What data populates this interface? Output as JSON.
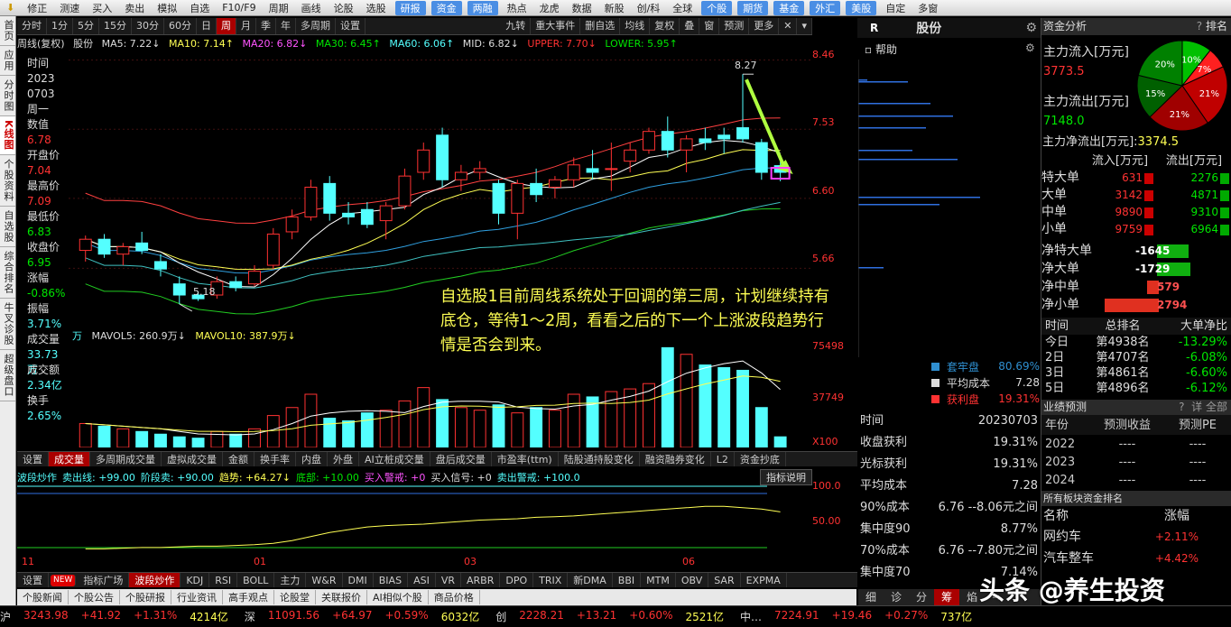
{
  "toolbar": {
    "items": [
      "修正",
      "测速",
      "买入",
      "卖出",
      "模拟",
      "自选",
      "F10/F9",
      "周期",
      "画线",
      "论股",
      "选股",
      "研报",
      "资金",
      "两融",
      "热点",
      "龙虎",
      "数据",
      "新股",
      "创/科",
      "全球",
      "个股",
      "期货",
      "基金",
      "外汇",
      "美股",
      "自定",
      "多窗"
    ],
    "highlighted": [
      "研报",
      "资金",
      "两融",
      "个股",
      "期货",
      "基金",
      "外汇",
      "美股"
    ]
  },
  "sidebar": {
    "items": [
      "首页",
      "应用",
      "分时图",
      "K线图",
      "个股资料",
      "自选股",
      "综合排名",
      "牛叉诊股",
      "超级盘口"
    ],
    "active": "K线图"
  },
  "period_tabs": [
    "分时",
    "1分",
    "5分",
    "15分",
    "30分",
    "60分",
    "日",
    "周",
    "月",
    "季",
    "年",
    "多周期",
    "设置"
  ],
  "active_period": "周",
  "right_tabs": [
    "九转",
    "重大事件",
    "删自选",
    "均线",
    "复权",
    "叠",
    "窗",
    "预测",
    "更多"
  ],
  "ma_line": {
    "title": "周线(复权)",
    "stock": "股份",
    "ma5": "MA5: 7.22↓",
    "ma10": "MA10: 7.14↑",
    "ma20": "MA20: 6.82↓",
    "ma30": "MA30: 6.45↑",
    "ma60": "MA60: 6.06↑",
    "mid": "MID: 6.82↓",
    "upper": "UPPER: 7.70↓",
    "lower": "LOWER: 5.95↑"
  },
  "info_panel": {
    "time_label": "时间",
    "year": "2023",
    "date": "0703",
    "weekday": "周一",
    "value_label": "数值",
    "value": "6.78",
    "open_label": "开盘价",
    "open": "7.04",
    "high_label": "最高价",
    "high": "7.09",
    "low_label": "最低价",
    "low": "6.83",
    "close_label": "收盘价",
    "close": "6.95",
    "change_label": "涨幅",
    "change": "-0.86%",
    "amp_label": "振幅",
    "amp": "3.71%",
    "vol_label": "成交量",
    "vol": "33.73万",
    "amt_label": "成交额",
    "amt": "2.34亿",
    "turn_label": "换手",
    "turn": "2.65%"
  },
  "price_axis": [
    "8.46",
    "7.53",
    "6.60",
    "5.66"
  ],
  "volume_axis": [
    "75498",
    "37749",
    "X100"
  ],
  "indicator_axis": [
    "100.0",
    "50.00"
  ],
  "date_axis": [
    "11",
    "01",
    "03",
    "06"
  ],
  "high_label": "8.27",
  "low_label": "5.18",
  "chart_data": {
    "type": "candlestick",
    "period": "weekly",
    "ohlc": [
      [
        5.9,
        6.1,
        5.75,
        6.05
      ],
      [
        6.05,
        6.12,
        5.8,
        5.85
      ],
      [
        5.85,
        6.0,
        5.7,
        5.95
      ],
      [
        6.0,
        6.15,
        5.85,
        5.9
      ],
      [
        5.75,
        5.85,
        5.55,
        5.65
      ],
      [
        5.45,
        5.55,
        5.18,
        5.3
      ],
      [
        5.3,
        5.35,
        5.22,
        5.25
      ],
      [
        5.3,
        5.55,
        5.25,
        5.48
      ],
      [
        5.48,
        5.55,
        5.35,
        5.4
      ],
      [
        5.45,
        5.7,
        5.42,
        5.62
      ],
      [
        5.7,
        6.2,
        5.65,
        6.12
      ],
      [
        6.15,
        6.45,
        6.05,
        6.35
      ],
      [
        6.35,
        6.85,
        6.3,
        6.75
      ],
      [
        6.8,
        6.9,
        6.3,
        6.4
      ],
      [
        6.4,
        6.55,
        6.25,
        6.35
      ],
      [
        6.45,
        6.55,
        6.2,
        6.25
      ],
      [
        6.3,
        6.55,
        6.05,
        6.5
      ],
      [
        6.5,
        7.0,
        6.45,
        6.9
      ],
      [
        6.95,
        7.35,
        6.85,
        7.25
      ],
      [
        7.45,
        7.55,
        6.75,
        6.85
      ],
      [
        6.85,
        7.05,
        6.7,
        6.95
      ],
      [
        6.95,
        7.1,
        6.85,
        7.0
      ],
      [
        6.8,
        6.85,
        6.25,
        6.4
      ],
      [
        6.4,
        6.85,
        6.05,
        6.8
      ],
      [
        6.8,
        7.0,
        6.55,
        6.65
      ],
      [
        6.75,
        6.9,
        6.6,
        6.85
      ],
      [
        6.85,
        7.15,
        6.75,
        7.05
      ],
      [
        7.0,
        7.25,
        6.85,
        6.95
      ],
      [
        7.0,
        7.35,
        6.7,
        7.0
      ],
      [
        7.1,
        7.35,
        6.95,
        7.25
      ],
      [
        7.25,
        7.55,
        7.2,
        7.5
      ],
      [
        7.5,
        7.7,
        7.15,
        7.25
      ],
      [
        7.25,
        7.45,
        6.95,
        7.4
      ],
      [
        7.4,
        7.55,
        7.25,
        7.35
      ],
      [
        7.45,
        7.55,
        7.2,
        7.4
      ],
      [
        7.55,
        8.27,
        7.35,
        7.4
      ],
      [
        7.35,
        7.4,
        6.85,
        6.95
      ],
      [
        7.04,
        7.09,
        6.83,
        6.95
      ]
    ],
    "volume": [
      18,
      16,
      14,
      12,
      10,
      8,
      7,
      12,
      10,
      14,
      24,
      30,
      40,
      22,
      20,
      26,
      28,
      35,
      45,
      36,
      30,
      28,
      32,
      26,
      30,
      28,
      40,
      38,
      42,
      44,
      48,
      75,
      70,
      62,
      60,
      58,
      30,
      8
    ],
    "ylim": [
      4.9,
      8.6
    ]
  },
  "annotation": "自选股1目前周线系统处于回调的第三周，计划继续持有底仓，等待1～2周，看看之后的下一个上涨波段趋势行情是否会到来。",
  "vol_line": {
    "prefix": "万",
    "mavol5": "MAVOL5: 260.9万↓",
    "mavol10": "MAVOL10: 387.9万↓"
  },
  "indicator_tabs": [
    "设置",
    "成交量",
    "多周期成交量",
    "虚拟成交量",
    "金额",
    "换手率",
    "内盘",
    "外盘",
    "AI立桩成交量",
    "盘后成交量",
    "市盈率(ttm)",
    "陆股通持股变化",
    "融资融券变化",
    "L2",
    "资金抄底"
  ],
  "indicator_active": "成交量",
  "indicator_line": {
    "name": "波段炒作",
    "sell_line": "卖出线: +99.00",
    "stage_sell": "阶段卖: +90.00",
    "trend": "趋势: +64.27↓",
    "bottom": "底部: +10.00",
    "buy_warn": "买入警戒: +0",
    "buy_sig": "买入信号: +0",
    "sell_warn": "卖出警戒: +100.0",
    "explain": "指标说明"
  },
  "formula_tabs": [
    "设置",
    "NEW",
    "指标广场",
    "波段炒作",
    "KDJ",
    "RSI",
    "BOLL",
    "主力",
    "W&R",
    "DMI",
    "BIAS",
    "ASI",
    "VR",
    "ARBR",
    "DPO",
    "TRIX",
    "新DMA",
    "BBI",
    "MTM",
    "OBV",
    "SAR",
    "EXPMA"
  ],
  "formula_active": "波段炒作",
  "news_tabs": [
    "个股新闻",
    "个股公告",
    "个股研报",
    "行业资讯",
    "高手观点",
    "论股堂",
    "关联报价",
    "AI相似个股",
    "商品价格"
  ],
  "status_bar": [
    {
      "label": "沪",
      "price": "3243.98",
      "chg": "+41.92",
      "pct": "+1.31%",
      "amt": "4214亿"
    },
    {
      "label": "深",
      "price": "11091.56",
      "chg": "+64.97",
      "pct": "+0.59%",
      "amt": "6032亿"
    },
    {
      "label": "创",
      "price": "2228.21",
      "chg": "+13.21",
      "pct": "+0.60%",
      "amt": "2521亿"
    },
    {
      "label": "中…",
      "price": "7224.91",
      "chg": "+19.46",
      "pct": "+0.27%",
      "amt": "737亿"
    }
  ],
  "mid_panel": {
    "code": "R",
    "stock": "股份",
    "help": "帮助",
    "legend": [
      {
        "name": "套牢盘",
        "value": "80.69%",
        "color": "#2f8fd0"
      },
      {
        "name": "平均成本",
        "value": "7.28",
        "color": "#dddddd"
      },
      {
        "name": "获利盘",
        "value": "19.31%",
        "color": "#ff3232"
      }
    ],
    "rows": [
      {
        "label": "时间",
        "value": "20230703"
      },
      {
        "label": "收盘获利",
        "value": "19.31%"
      },
      {
        "label": "光标获利",
        "value": "19.31%"
      },
      {
        "label": "平均成本",
        "value": "7.28"
      },
      {
        "label": "90%成本",
        "value": "6.76",
        "extra": "--8.06元之间"
      },
      {
        "label": "集中度90",
        "value": "8.77%"
      },
      {
        "label": "70%成本",
        "value": "6.76",
        "extra": "--7.80元之间"
      },
      {
        "label": "集中度70",
        "value": "7.14%"
      }
    ],
    "tabs": [
      "细",
      "诊",
      "分",
      "筹",
      "焰",
      "→"
    ]
  },
  "right_panel": {
    "title": "资金分析",
    "tab": "排名",
    "inflow_label": "主力流入[万元]",
    "inflow": "3773.5",
    "outflow_label": "主力流出[万元]",
    "outflow": "7148.0",
    "net_label": "主力净流出[万元]:",
    "net": "3374.5",
    "pie": [
      {
        "label": "10%",
        "value": 10,
        "color": "#00c000"
      },
      {
        "label": "7%",
        "value": 7,
        "color": "#ff2020"
      },
      {
        "label": "21%",
        "value": 21,
        "color": "#c00000"
      },
      {
        "label": "21%",
        "value": 21,
        "color": "#a00000"
      },
      {
        "label": "15%",
        "value": 15,
        "color": "#006000"
      },
      {
        "label": "20%",
        "value": 20,
        "color": "#008000"
      }
    ],
    "flow_head": [
      "流入[万元]",
      "流出[万元]"
    ],
    "flows": [
      {
        "label": "特大单",
        "in": "631",
        "out": "2276"
      },
      {
        "label": "大单",
        "in": "3142",
        "out": "4871"
      },
      {
        "label": "中单",
        "in": "9890",
        "out": "9310"
      },
      {
        "label": "小单",
        "in": "9759",
        "out": "6964"
      }
    ],
    "nets": [
      {
        "label": "净特大单",
        "value": "-1645",
        "pos": false,
        "frac": 0.59
      },
      {
        "label": "净大单",
        "value": "-1729",
        "pos": false,
        "frac": 0.62
      },
      {
        "label": "净中单",
        "value": "579",
        "pos": true,
        "frac": 0.21
      },
      {
        "label": "净小单",
        "value": "2794",
        "pos": true,
        "frac": 1.0
      }
    ],
    "rank_head": [
      "时间",
      "总排名",
      "大单净比"
    ],
    "ranks": [
      {
        "t": "今日",
        "rank": "第4938名",
        "ratio": "-13.29%"
      },
      {
        "t": "2日",
        "rank": "第4707名",
        "ratio": "-6.08%"
      },
      {
        "t": "3日",
        "rank": "第4861名",
        "ratio": "-6.60%"
      },
      {
        "t": "5日",
        "rank": "第4896名",
        "ratio": "-6.12%"
      }
    ],
    "forecast_title": "业绩预测",
    "forecast_btns": [
      "?",
      "详",
      "全部"
    ],
    "forecast_head": [
      "年份",
      "预测收益",
      "预测PE"
    ],
    "forecast": [
      {
        "year": "2022",
        "eps": "----",
        "pe": "----"
      },
      {
        "year": "2023",
        "eps": "----",
        "pe": "----"
      },
      {
        "year": "2024",
        "eps": "----",
        "pe": "----"
      }
    ],
    "sector_title": "所有板块资金排名",
    "sector_head": [
      "名称",
      "涨幅"
    ],
    "sectors": [
      {
        "name": "网约车",
        "pct": "+2.11%"
      },
      {
        "name": "汽车整车",
        "pct": "+4.42%"
      }
    ]
  },
  "watermark": "头条 @养生投资"
}
